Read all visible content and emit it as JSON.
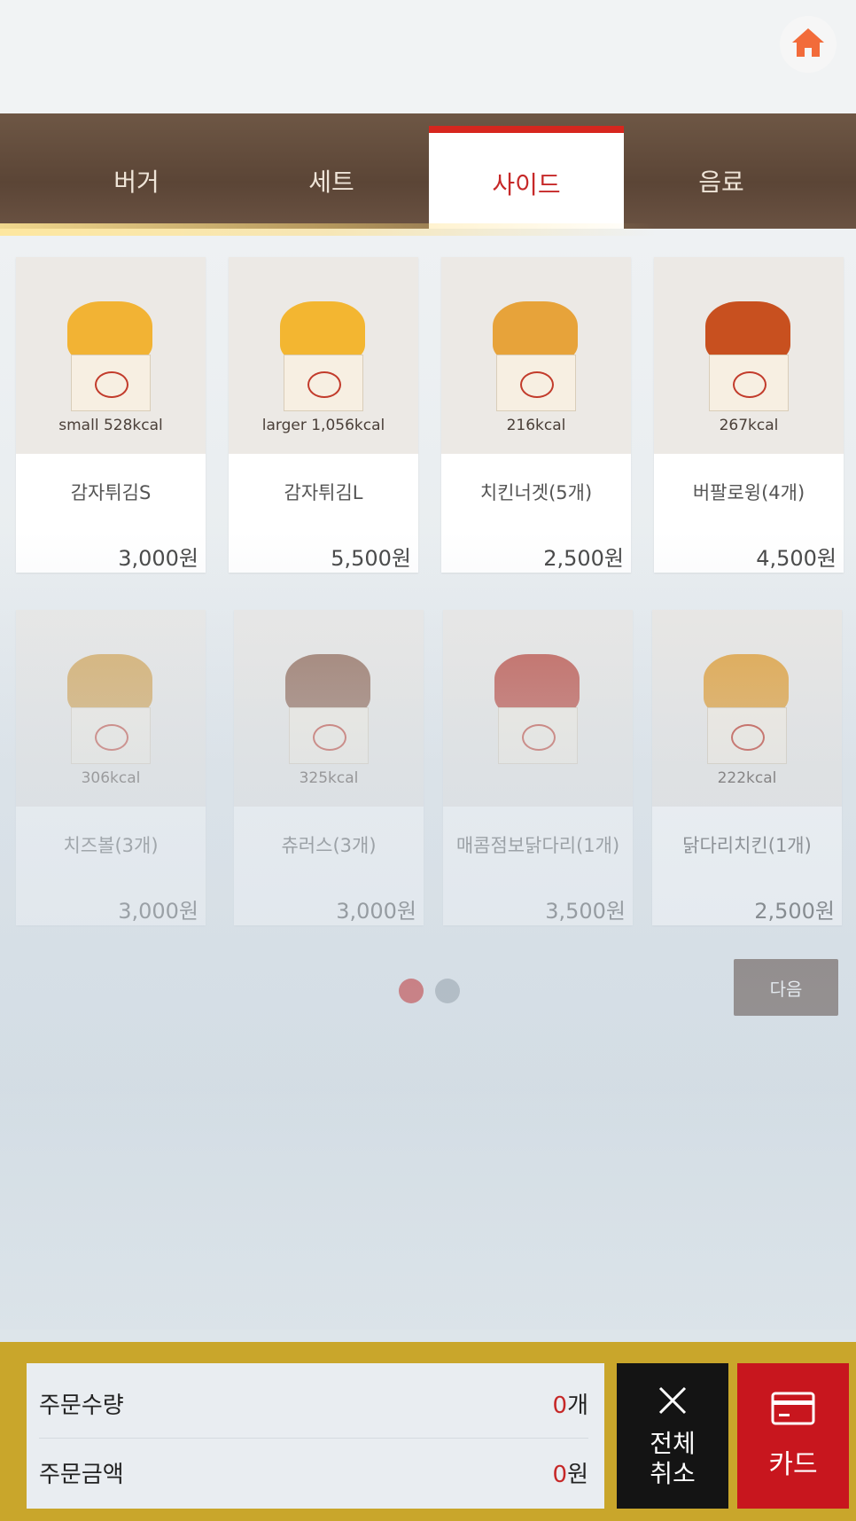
{
  "header": {
    "home_icon": "home-icon",
    "home_color": "#f26b3a"
  },
  "tabs": [
    {
      "label": "버거"
    },
    {
      "label": "세트"
    },
    {
      "label": "사이드"
    },
    {
      "label": "음료"
    }
  ],
  "active_tab": "사이드",
  "items": [
    {
      "name": "감자튀김S",
      "kcal": "small 528kcal",
      "price": "3,000원"
    },
    {
      "name": "감자튀김L",
      "kcal": "larger 1,056kcal",
      "price": "5,500원"
    },
    {
      "name": "치킨너겟(5개)",
      "kcal": "216kcal",
      "price": "2,500원"
    },
    {
      "name": "버팔로윙(4개)",
      "kcal": "267kcal",
      "price": "4,500원"
    },
    {
      "name": "치즈볼(3개)",
      "kcal": "306kcal",
      "price": "3,000원"
    },
    {
      "name": "츄러스(3개)",
      "kcal": "325kcal",
      "price": "3,000원"
    },
    {
      "name": "매콤점보닭다리(1개)",
      "kcal": "",
      "price": "3,500원"
    },
    {
      "name": "닭다리치킨(1개)",
      "kcal": "222kcal",
      "price": "2,500원"
    }
  ],
  "pagination": {
    "current": 1,
    "total": 2,
    "active_color": "#c62828",
    "inactive_color": "#9aa3ab"
  },
  "next_button": {
    "label": "다음"
  },
  "summary": {
    "qty_label": "주문수량",
    "qty_value": "0",
    "qty_unit": "개",
    "amount_label": "주문금액",
    "amount_value": "0",
    "amount_unit": "원"
  },
  "cancel_button": {
    "line1": "전체",
    "line2": "취소",
    "icon": "close-icon"
  },
  "card_button": {
    "label": "카드",
    "icon": "credit-card-icon"
  }
}
